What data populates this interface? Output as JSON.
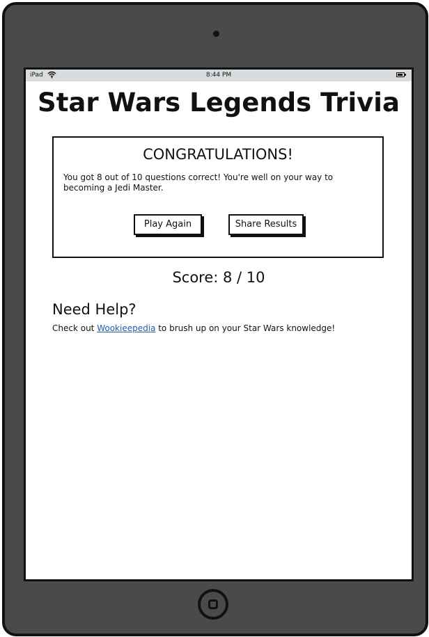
{
  "status_bar": {
    "carrier": "iPad",
    "time": "8:44 PM"
  },
  "app": {
    "title": "Star Wars Legends Trivia"
  },
  "result": {
    "heading": "CONGRATULATIONS!",
    "message": "You got 8 out of 10 questions correct! You're well on your way to becoming a Jedi Master.",
    "play_again_label": "Play Again",
    "share_label": "Share Results"
  },
  "score": {
    "text": "Score: 8 / 10"
  },
  "help": {
    "title": "Need Help?",
    "prefix": "Check out ",
    "link_text": "Wookieepedia",
    "suffix": " to brush up on your Star Wars knowledge!"
  },
  "colors": {
    "device_body": "#4a4a4a",
    "status_bar": "#d8dcdf",
    "link": "#1f5ea8"
  },
  "icons": [
    "wifi-icon",
    "battery-icon",
    "camera-icon",
    "home-button-icon"
  ]
}
